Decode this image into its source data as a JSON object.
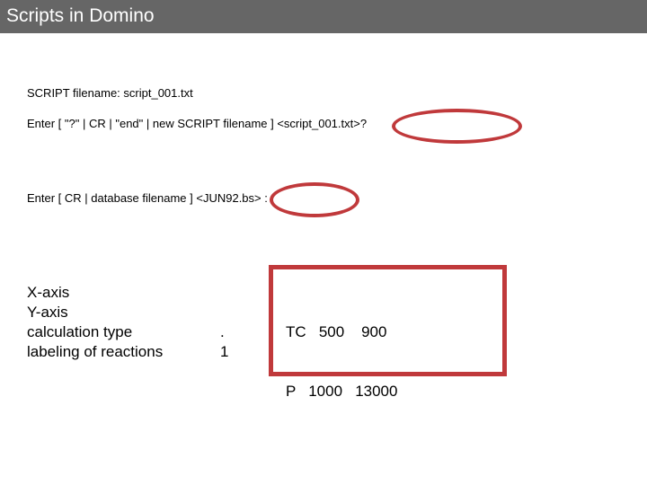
{
  "header": {
    "title": "Scripts in Domino"
  },
  "prompts": {
    "script_filename": "SCRIPT filename: script_001.txt",
    "enter_script": "Enter [ \"?\" | CR | \"end\" | new SCRIPT filename ] <script_001.txt>?",
    "enter_database": "Enter [ CR | database filename ] <JUN92.bs> :"
  },
  "settings": {
    "labels": [
      "X-axis",
      "Y-axis",
      "calculation type",
      "labeling of reactions"
    ],
    "values": [
      ".",
      "1"
    ]
  },
  "ranges": {
    "tc_line": "TC   500    900",
    "p_line": "P   1000   13000"
  },
  "colors": {
    "title_bar": "#666666",
    "highlight": "#c0393b"
  }
}
